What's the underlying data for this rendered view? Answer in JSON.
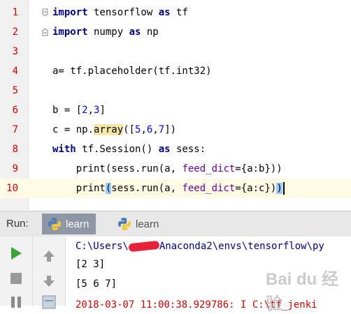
{
  "editor": {
    "lines": [
      {
        "num": "1"
      },
      {
        "num": "2"
      },
      {
        "num": "3"
      },
      {
        "num": "4"
      },
      {
        "num": "5"
      },
      {
        "num": "6"
      },
      {
        "num": "7"
      },
      {
        "num": "8"
      },
      {
        "num": "9"
      },
      {
        "num": "10"
      }
    ],
    "code": {
      "l1_kw1": "import",
      "l1_mid": " tensorflow ",
      "l1_kw2": "as",
      "l1_end": " tf",
      "l2_kw1": "import",
      "l2_mid": " numpy ",
      "l2_kw2": "as",
      "l2_end": " np",
      "l4": "a= tf.placeholder(tf.int32)",
      "l6_a": "b = [",
      "l6_n1": "2",
      "l6_c": ",",
      "l6_n2": "3",
      "l6_b": "]",
      "l7_a": "c = np.",
      "l7_fn": "array",
      "l7_b": "([",
      "l7_n1": "5",
      "l7_c1": ",",
      "l7_n2": "6",
      "l7_c2": ",",
      "l7_n3": "7",
      "l7_e": "])",
      "l8_kw1": "with",
      "l8_mid": " tf.Session() ",
      "l8_kw2": "as",
      "l8_end": " sess:",
      "l9_a": "    print(sess.run(a, ",
      "l9_p": "feed_dict",
      "l9_b": "={a:b}))",
      "l10_a": "    print",
      "l10_br": "(",
      "l10_b": "sess.run(a, ",
      "l10_p": "feed_dict",
      "l10_c": "={a:c})",
      "l10_br2": ")"
    }
  },
  "runbar": {
    "label": "Run:",
    "tabs": [
      {
        "label": "learn"
      },
      {
        "label": "learn"
      }
    ]
  },
  "console": {
    "path_prefix": "C:\\Users\\",
    "path_suffix": "Anaconda2\\envs\\tensorflow\\py",
    "out1": "[2 3]",
    "out2": "[5 6 7]",
    "out3": "2018-03-07 11:00:38.929786: I C:\\tf_jenki"
  },
  "colors": {
    "accent": "#8e97a3",
    "line_number": "#cc0000",
    "keyword": "#000080",
    "number": "#0000ff",
    "param": "#660099"
  },
  "watermark": "Bai du 经验"
}
